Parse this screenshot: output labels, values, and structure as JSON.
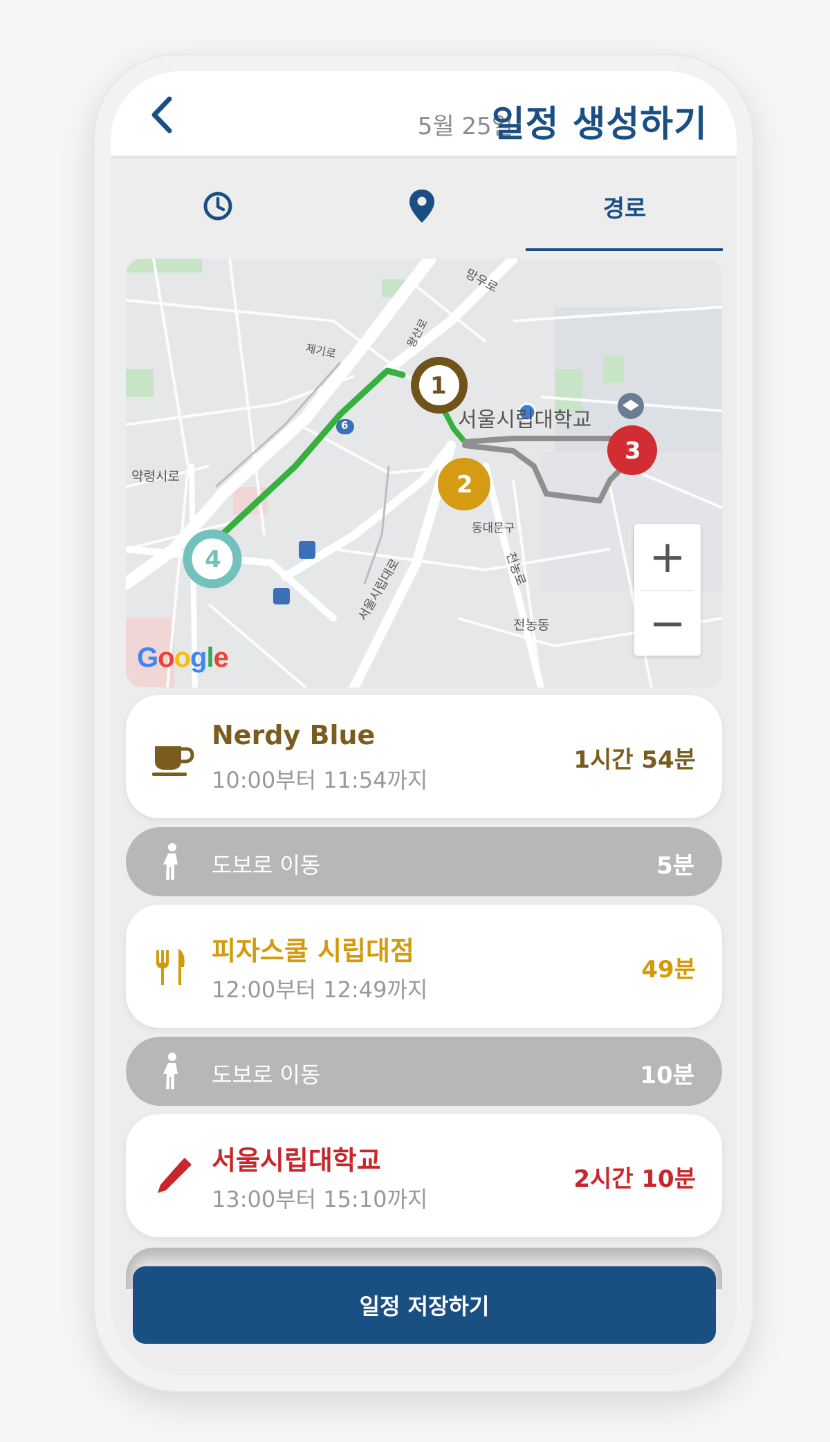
{
  "header": {
    "date": "5월 25일",
    "title": "일정 생성하기"
  },
  "tabs": [
    {
      "icon": "clock-icon"
    },
    {
      "icon": "location-pin-icon"
    },
    {
      "label": "경로",
      "active": true
    }
  ],
  "map": {
    "labels": {
      "majorRoad": "망우로",
      "road2": "제기로",
      "road3": "왕산로",
      "road4": "약령시로",
      "campus": "서울시립대학교",
      "district": "동대문구",
      "road5": "서울시립대로",
      "road6": "천농로",
      "area": "전농동",
      "lineBadge": "6",
      "logo": "Google"
    },
    "markers": [
      "1",
      "2",
      "3",
      "4"
    ],
    "zoom": {
      "in": "+",
      "out": "−"
    }
  },
  "schedule": [
    {
      "type": "place",
      "icon": "coffee-cup-icon",
      "name": "Nerdy Blue",
      "time": "10:00부터 11:54까지",
      "duration": "1시간 54분",
      "color": "#7a5c1e"
    },
    {
      "type": "walk",
      "icon": "walking-person-icon",
      "label": "도보로 이동",
      "duration": "5분"
    },
    {
      "type": "place",
      "icon": "fork-knife-icon",
      "name": "피자스쿨 시립대점",
      "time": "12:00부터 12:49까지",
      "duration": "49분",
      "color": "#d39a0c"
    },
    {
      "type": "walk",
      "icon": "walking-person-icon",
      "label": "도보로 이동",
      "duration": "10분"
    },
    {
      "type": "place",
      "icon": "pencil-icon",
      "name": "서울시립대학교",
      "time": "13:00부터 15:10까지",
      "duration": "2시간 10분",
      "color": "#c9262c"
    }
  ],
  "save_button": "일정 저장하기",
  "colors": {
    "primary": "#1a4f84",
    "routeGreen": "#36b03f",
    "routeGray": "#8f8f8f",
    "marker1": "#6f5318",
    "marker2": "#d59b12",
    "marker3": "#d12d32",
    "marker4": "#73c1bd"
  }
}
